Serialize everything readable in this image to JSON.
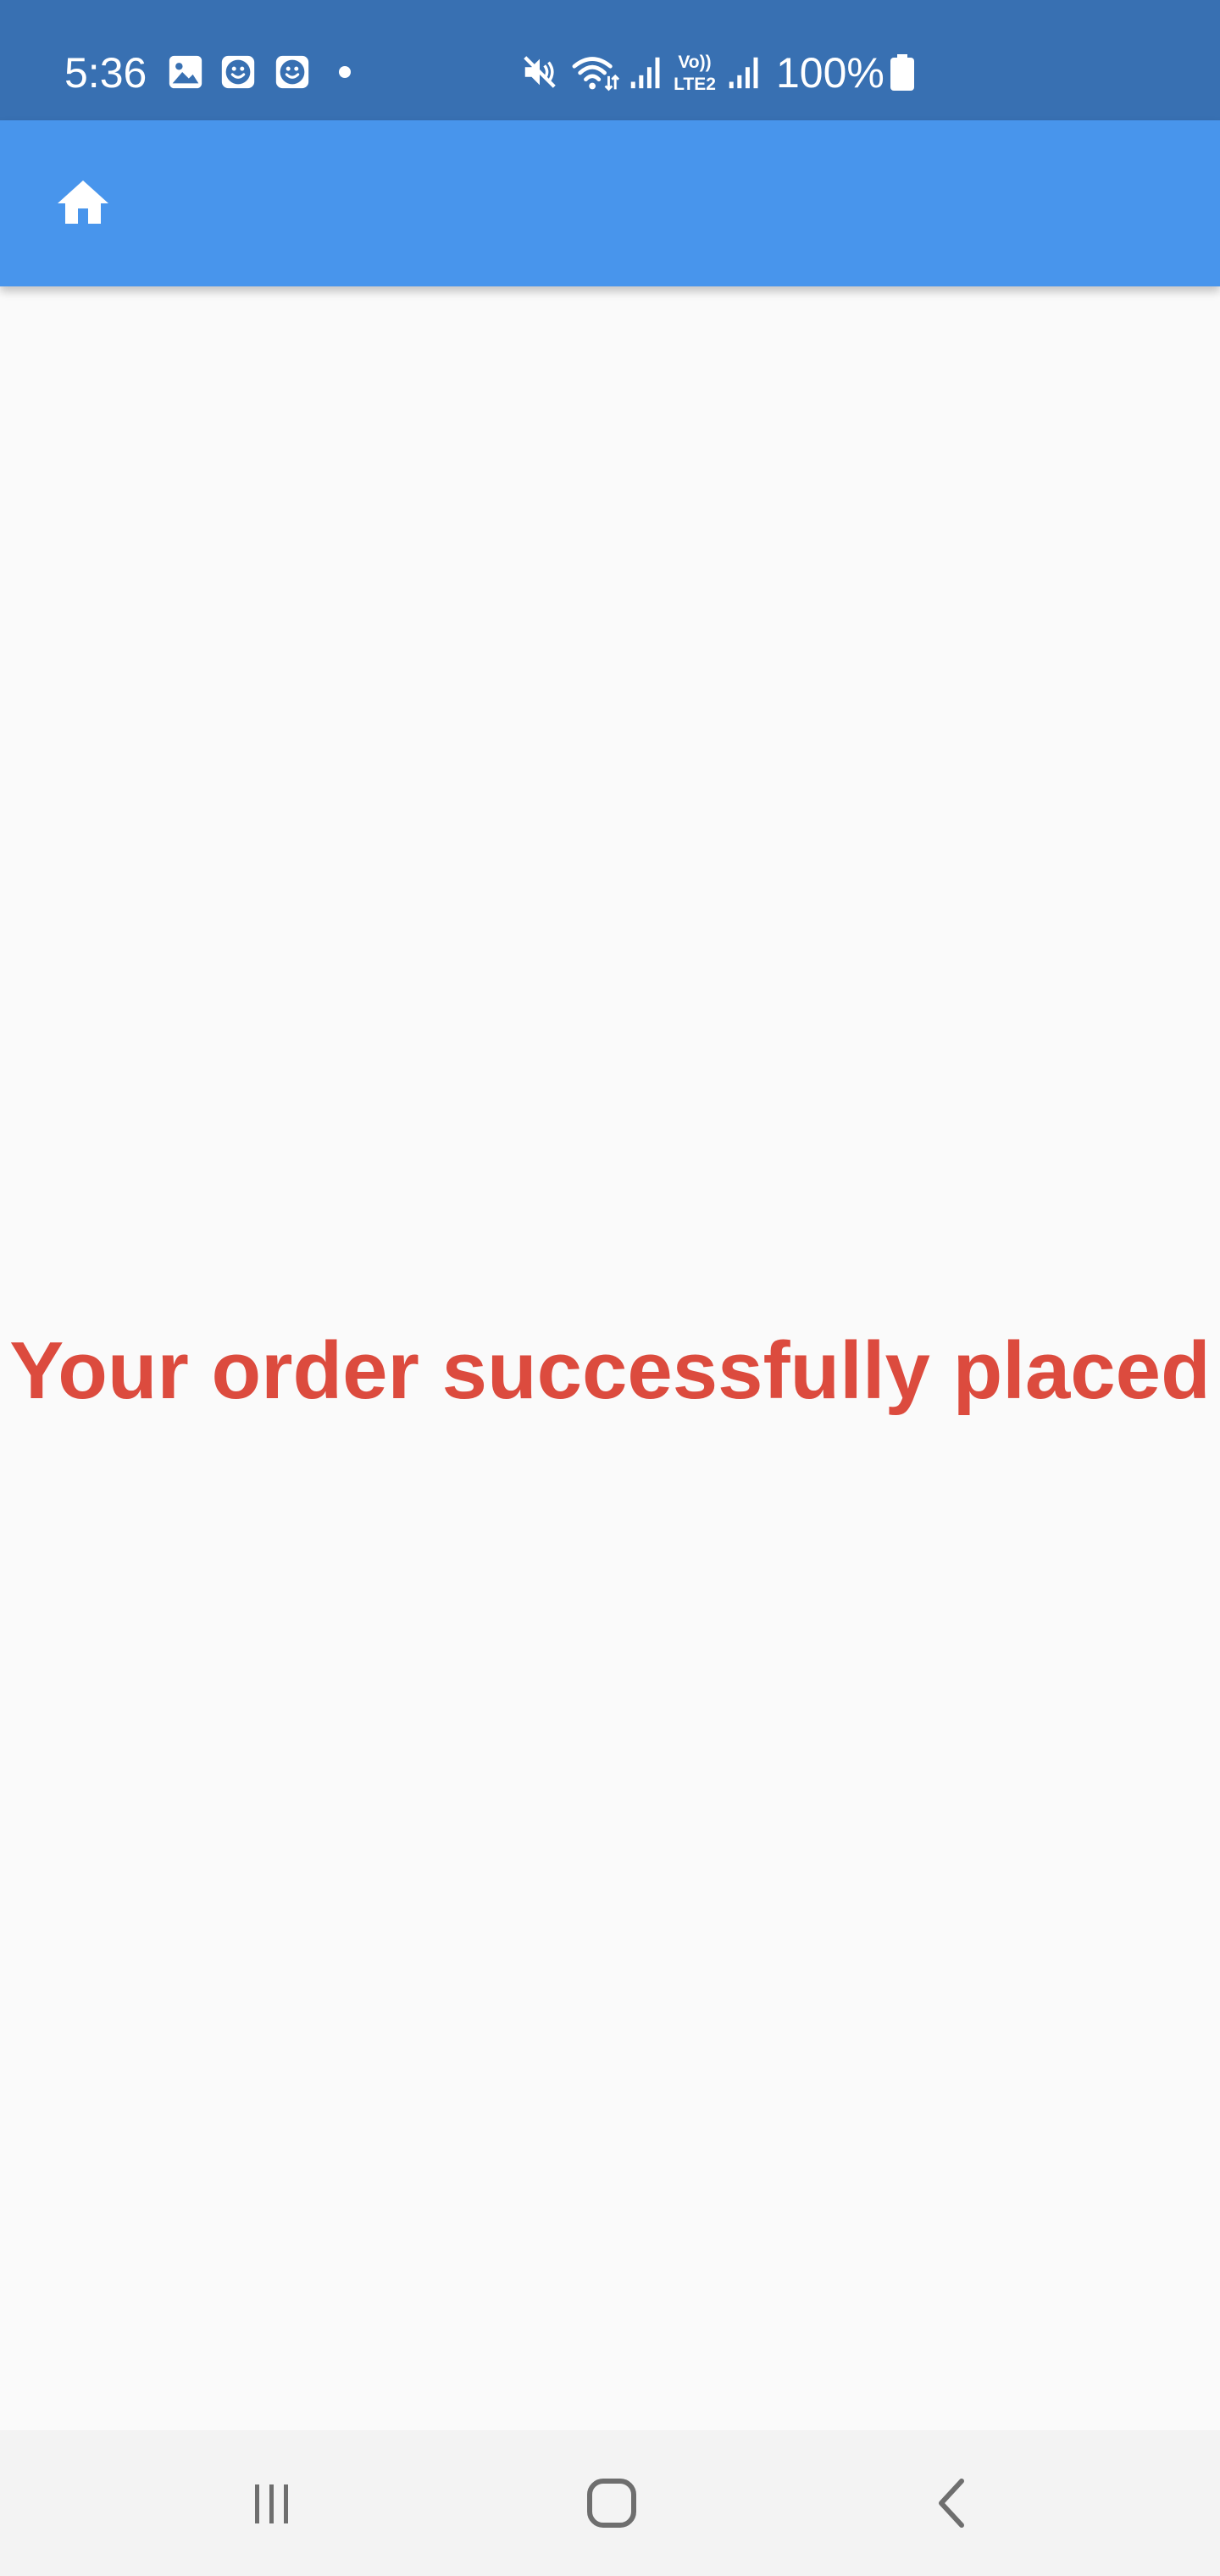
{
  "status_bar": {
    "time": "5:36",
    "battery_percent": "100%",
    "network_label_top": "Vo))",
    "network_label_bottom": "LTE2",
    "icons": [
      "gallery-icon",
      "face-icon",
      "face-icon",
      "dot-icon",
      "mute-icon",
      "wifi-icon",
      "signal-icon",
      "signal-icon",
      "battery-icon"
    ]
  },
  "app_bar": {
    "icon": "home-icon"
  },
  "main": {
    "message": "Your order successfully placed"
  },
  "nav_bar": {
    "icons": [
      "recent-apps-icon",
      "home-button-icon",
      "back-icon"
    ]
  },
  "colors": {
    "status_bar": "#3870b2",
    "app_bar": "#4895ec",
    "background": "#fafafa",
    "message": "#dc4b3e",
    "nav_bar": "#f3f3f3"
  }
}
